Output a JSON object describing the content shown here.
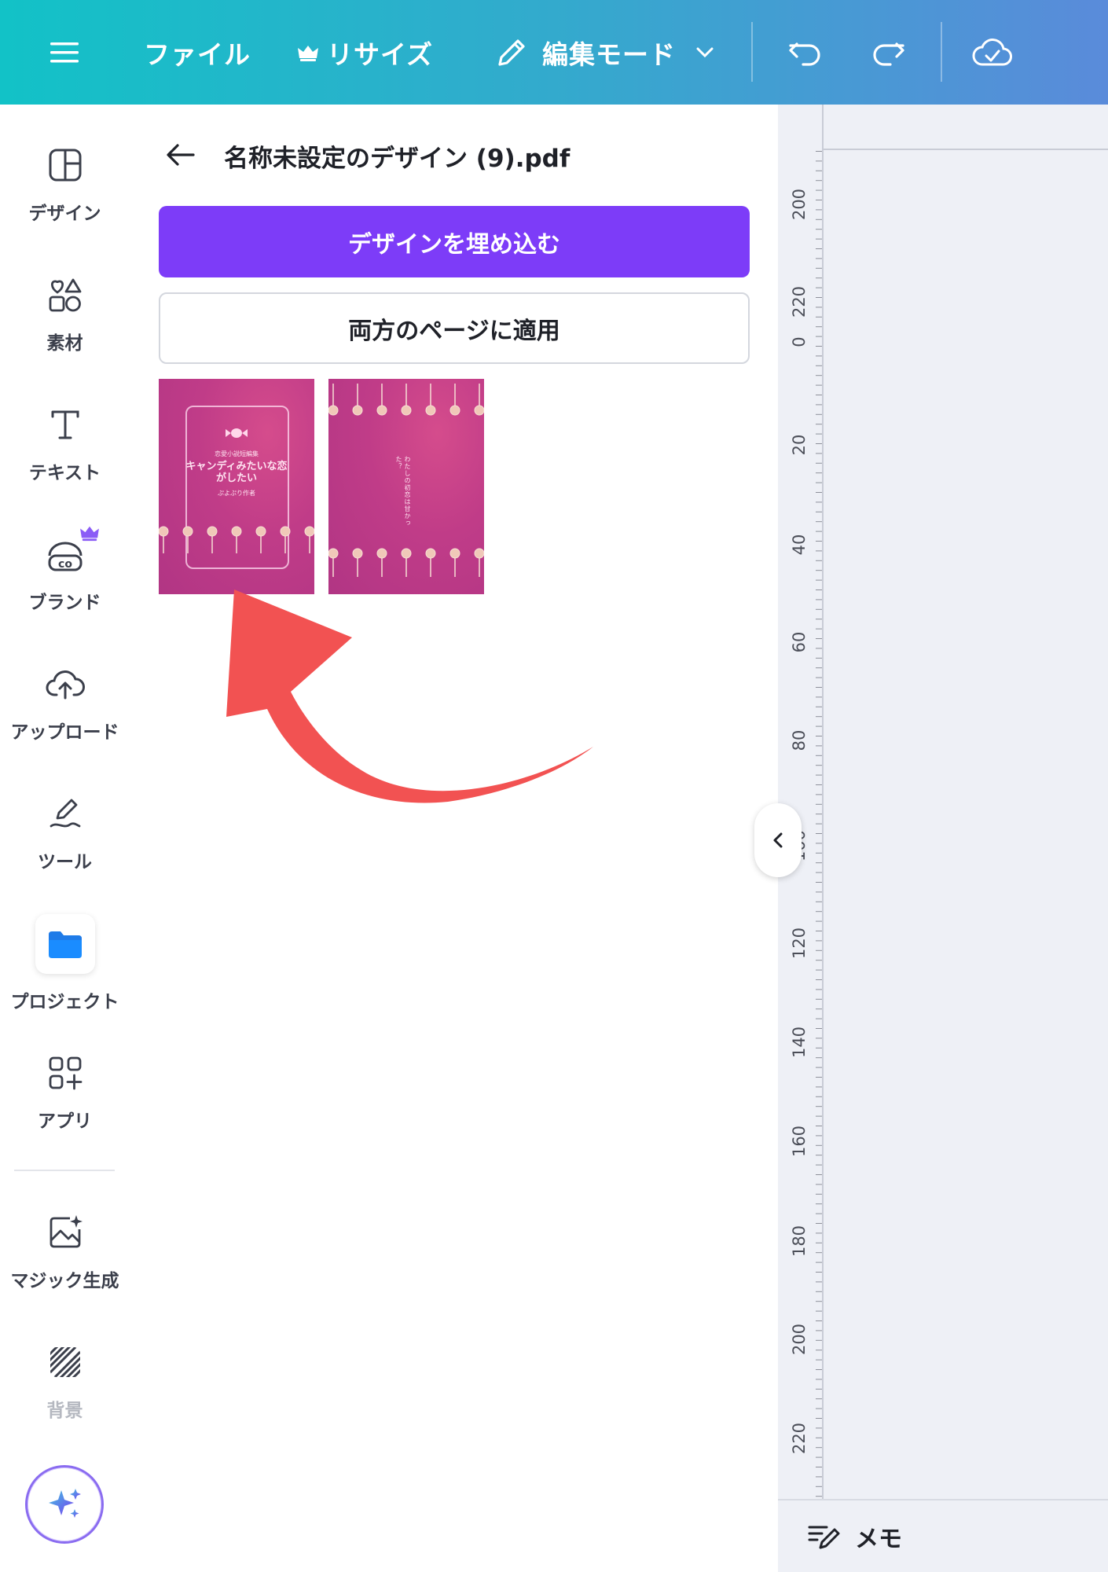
{
  "topbar": {
    "file_label": "ファイル",
    "resize_label": "リサイズ",
    "edit_mode_label": "編集モード"
  },
  "rail": {
    "items": [
      {
        "label": "デザイン",
        "icon": "layout-icon"
      },
      {
        "label": "素材",
        "icon": "shapes-icon"
      },
      {
        "label": "テキスト",
        "icon": "text-icon"
      },
      {
        "label": "ブランド",
        "icon": "brand-icon"
      },
      {
        "label": "アップロード",
        "icon": "cloud-upload-icon"
      },
      {
        "label": "ツール",
        "icon": "pen-tool-icon"
      },
      {
        "label": "プロジェクト",
        "icon": "folder-icon"
      },
      {
        "label": "アプリ",
        "icon": "apps-icon"
      },
      {
        "label": "マジック生成",
        "icon": "magic-image-icon"
      },
      {
        "label": "背景",
        "icon": "background-hatch-icon"
      }
    ]
  },
  "panel": {
    "title": "名称未設定のデザイン (9).pdf",
    "embed_button": "デザインを埋め込む",
    "apply_button": "両方のページに適用",
    "pages": [
      {
        "small_top": "恋愛小説短編集",
        "title_line1": "キャンディみたいな恋",
        "title_line2": "がしたい",
        "small_bottom": "ぷよぷり作者"
      },
      {
        "vertical_text": "わたしの初恋は甘かった？"
      }
    ]
  },
  "ruler": {
    "labels": [
      "200",
      "220",
      "0",
      "20",
      "40",
      "60",
      "80",
      "100",
      "120",
      "140",
      "160",
      "180",
      "200",
      "220"
    ]
  },
  "memo": {
    "label": "メモ"
  },
  "colors": {
    "topbar_start": "#12c2c7",
    "topbar_end": "#5a8bda",
    "primary_purple": "#7d3cf8",
    "annotation_arrow": "#f25252",
    "thumbnail_pink": "#c03c88"
  }
}
